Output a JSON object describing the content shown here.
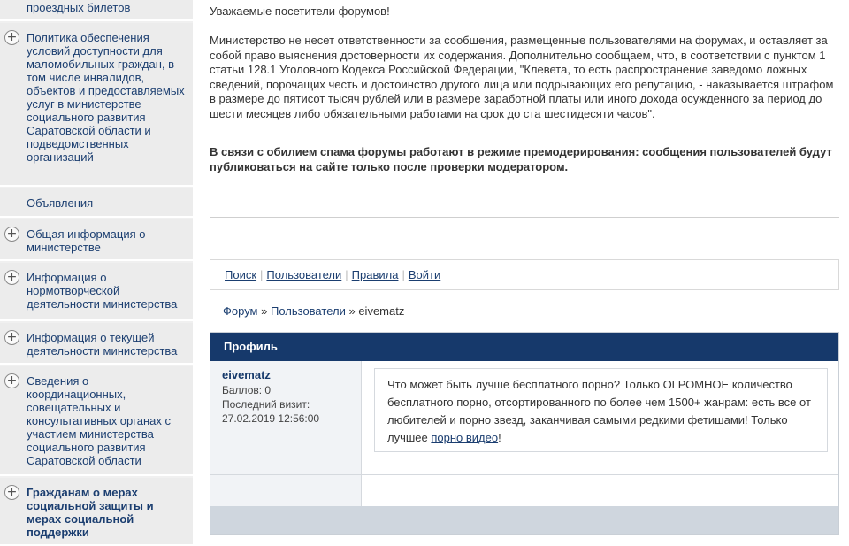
{
  "sidebar": {
    "items": [
      {
        "label": "проездных билетов",
        "has_plus": false,
        "bold": false
      },
      {
        "label": "Политика обеспечения условий доступности для маломобильных граждан, в том числе инвалидов, объектов и предоставляемых услуг в министерстве социального развития Саратовской области и подведомственных организаций",
        "has_plus": true,
        "bold": false
      },
      {
        "label": "Объявления",
        "has_plus": false,
        "bold": false
      },
      {
        "label": "Общая информация о министерстве",
        "has_plus": true,
        "bold": false
      },
      {
        "label": "Информация о нормотворческой деятельности министерства",
        "has_plus": true,
        "bold": false
      },
      {
        "label": "Информация о текущей деятельности министерства",
        "has_plus": true,
        "bold": false
      },
      {
        "label": "Сведения о координационных, совещательных и консультативных органах с участием министерства социального развития Саратовской области",
        "has_plus": true,
        "bold": false
      },
      {
        "label": "Гражданам о мерах социальной защиты и мерах социальной поддержки",
        "has_plus": true,
        "bold": true
      }
    ]
  },
  "notice": {
    "greeting": "Уважаемые посетители форумов!",
    "disclaimer": "Министерство не несет ответственности за сообщения, размещенные пользователями на форумах, и оставляет за собой право выяснения достоверности их содержания. Дополнительно сообщаем, что, в соответствии с пунктом 1 статьи 128.1 Уголовного Кодекса Российской Федерации, \"Клевета, то есть распространение заведомо ложных сведений, порочащих честь и достоинство другого лица или подрывающих его репутацию, - наказывается штрафом в размере до пятисот тысяч рублей или в размере заработной платы или иного дохода осужденного за период до шести месяцев либо обязательными работами на срок до ста шестидесяти часов\".",
    "spam_warning": "В связи с обилием спама форумы работают в режиме премодерирования: сообщения пользователей будут публиковаться на сайте только после проверки модератором."
  },
  "forum_nav": {
    "search": "Поиск",
    "users": "Пользователи",
    "rules": "Правила",
    "login": "Войти"
  },
  "breadcrumb": {
    "forum": "Форум",
    "users": "Пользователи",
    "current": "eivematz",
    "separator": "»"
  },
  "profile": {
    "header": "Профиль",
    "username": "eivematz",
    "points": "Баллов: 0",
    "last_visit_label": "Последний визит:",
    "last_visit": "27.02.2019 12:56:00",
    "post_text": "Что может быть лучше бесплатного порно? Только ОГРОМНОЕ количество бесплатного порно, отсортированного по более чем 1500+ жанрам: есть все от любителей и порно звезд, заканчивая самыми редкими фетишами! Только лучшее ",
    "post_link": "порно видео",
    "post_end": "!"
  },
  "colors": {
    "header_bg": "#16396b",
    "link": "#1b3e70",
    "sidebar_bg": "#ececec"
  }
}
